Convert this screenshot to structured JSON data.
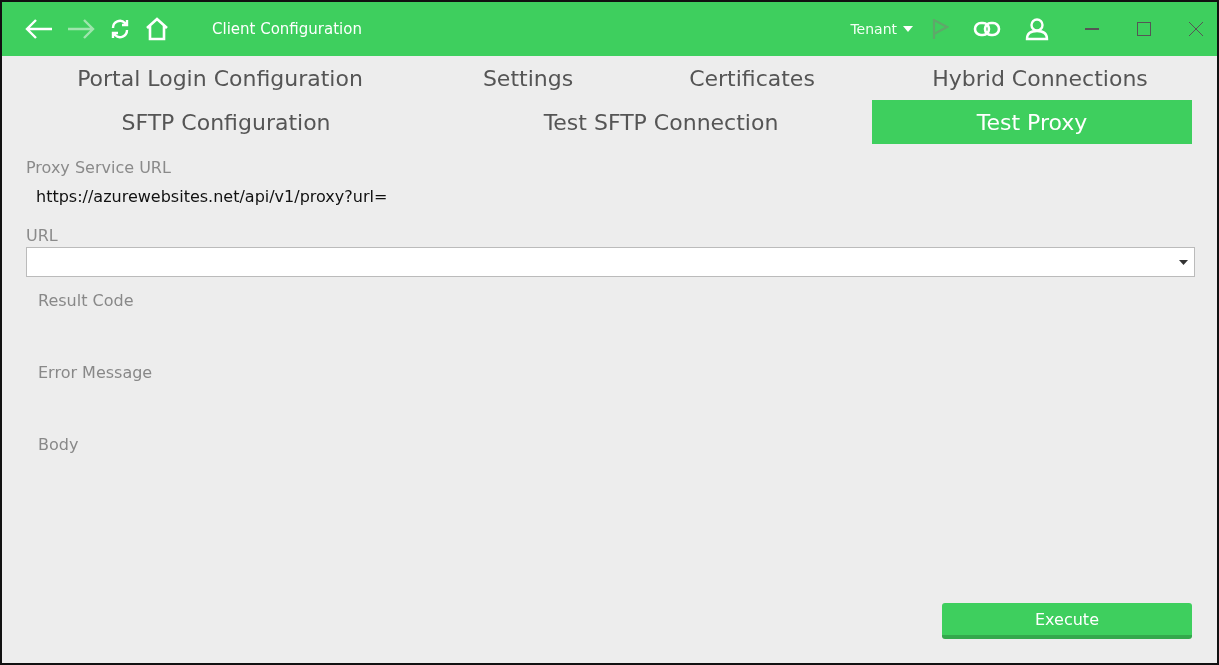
{
  "window": {
    "title": "Client Configuration",
    "tenant": "Tenant"
  },
  "tab_rows": [
    [
      {
        "label": "Portal Login Configuration",
        "selected": false
      },
      {
        "label": "Settings",
        "selected": false
      },
      {
        "label": "Certificates",
        "selected": false
      },
      {
        "label": "Hybrid Connections",
        "selected": false
      }
    ],
    [
      {
        "label": "SFTP Configuration",
        "selected": false
      },
      {
        "label": "Test SFTP Connection",
        "selected": false
      },
      {
        "label": "Test Proxy",
        "selected": true
      }
    ]
  ],
  "fields": [
    {
      "kind": "readonly",
      "label": "Proxy Service URL",
      "value": "https://azurewebsites.net/api/v1/proxy?url="
    },
    {
      "kind": "combo",
      "label": "URL"
    },
    {
      "kind": "output",
      "label": "Result Code"
    },
    {
      "kind": "output",
      "label": "Error Message"
    },
    {
      "kind": "output",
      "label": "Body"
    }
  ],
  "buttons": [
    "Execute"
  ]
}
